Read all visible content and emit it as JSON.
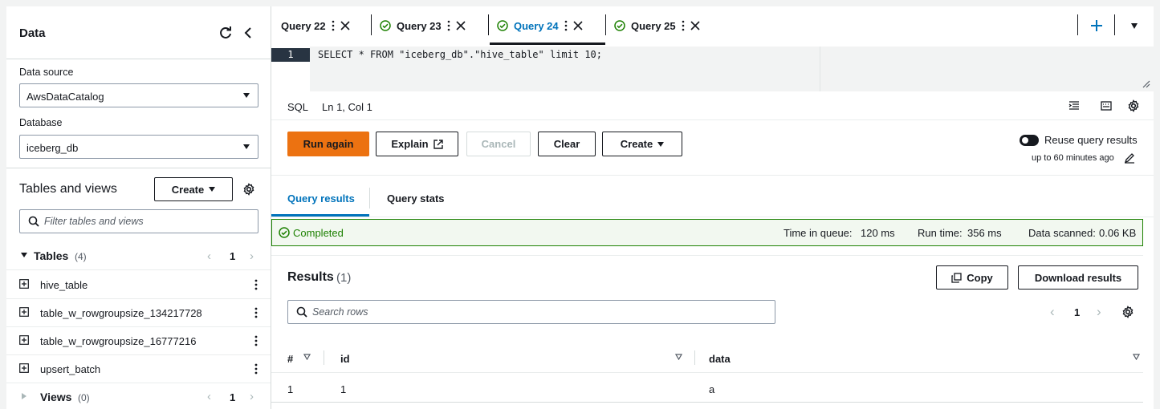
{
  "sidebar": {
    "title": "Data",
    "data_source_label": "Data source",
    "data_source_value": "AwsDataCatalog",
    "database_label": "Database",
    "database_value": "iceberg_db",
    "tables_views_title": "Tables and views",
    "create_label": "Create",
    "filter_placeholder": "Filter tables and views",
    "tables_label": "Tables",
    "tables_count": "(4)",
    "tables_page": "1",
    "tables": [
      "hive_table",
      "table_w_rowgroupsize_134217728",
      "table_w_rowgroupsize_16777216",
      "upsert_batch"
    ],
    "views_label": "Views",
    "views_count": "(0)",
    "views_page": "1"
  },
  "tabs": [
    {
      "label": "Query 22",
      "completed": false,
      "active": false
    },
    {
      "label": "Query 23",
      "completed": true,
      "active": false
    },
    {
      "label": "Query 24",
      "completed": true,
      "active": true
    },
    {
      "label": "Query 25",
      "completed": true,
      "active": false
    }
  ],
  "editor": {
    "line_number": "1",
    "code": "SELECT * FROM \"iceberg_db\".\"hive_table\" limit 10;",
    "language": "SQL",
    "cursor": "Ln 1, Col 1"
  },
  "actions": {
    "run_again": "Run again",
    "explain": "Explain",
    "cancel": "Cancel",
    "clear": "Clear",
    "create": "Create",
    "reuse_label": "Reuse query results",
    "reuse_sub": "up to 60 minutes ago"
  },
  "result_tabs": {
    "results": "Query results",
    "stats": "Query stats"
  },
  "status": {
    "completed": "Completed",
    "queue_label": "Time in queue:",
    "queue_value": "120 ms",
    "run_label": "Run time:",
    "run_value": "356 ms",
    "scanned_label": "Data scanned:",
    "scanned_value": "0.06 KB"
  },
  "results": {
    "title": "Results",
    "count": "(1)",
    "copy": "Copy",
    "download": "Download results",
    "search_placeholder": "Search rows",
    "page": "1",
    "columns": [
      "#",
      "id",
      "data"
    ],
    "rows": [
      [
        "1",
        "1",
        "a"
      ]
    ]
  },
  "colors": {
    "accent": "#0073bb",
    "run_button": "#ec7211",
    "success": "#1d8102"
  }
}
